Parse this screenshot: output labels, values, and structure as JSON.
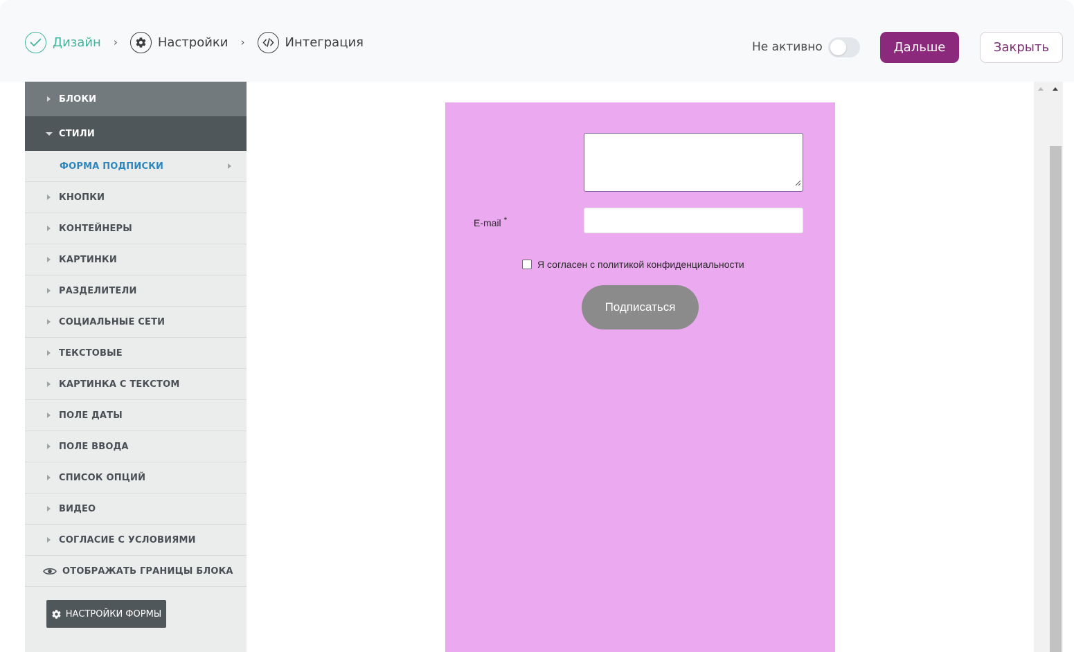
{
  "steps": [
    {
      "label": "Дизайн",
      "icon": "check-icon",
      "state": "done"
    },
    {
      "label": "Настройки",
      "icon": "gear-icon",
      "state": "pending"
    },
    {
      "label": "Интеграция",
      "icon": "code-icon",
      "state": "pending"
    }
  ],
  "step_separator": "›",
  "header": {
    "status_label": "Не активно",
    "toggle_on": false,
    "next_label": "Дальше",
    "close_label": "Закрыть",
    "accent_color": "#8b2a7d",
    "done_color": "#43b49c"
  },
  "sidebar": {
    "blocks_label": "БЛОКИ",
    "styles_label": "СТИЛИ",
    "active_item": "ФОРМА ПОДПИСКИ",
    "items": [
      "КНОПКИ",
      "КОНТЕЙНЕРЫ",
      "КАРТИНКИ",
      "РАЗДЕЛИТЕЛИ",
      "СОЦИАЛЬНЫЕ СЕТИ",
      "ТЕКСТОВЫЕ",
      "КАРТИНКА С ТЕКСТОМ",
      "ПОЛЕ ДАТЫ",
      "ПОЛЕ ВВОДА",
      "СПИСОК ОПЦИЙ",
      "ВИДЕО",
      "СОГЛАСИЕ С УСЛОВИЯМИ"
    ],
    "show_borders_label": "ОТОБРАЖАТЬ ГРАНИЦЫ БЛОКА",
    "form_settings_label": "НАСТРОЙКИ ФОРМЫ"
  },
  "preview": {
    "background_color": "#eba9ef",
    "textarea_value": "",
    "email_label": "E-mail",
    "email_required_mark": "*",
    "email_value": "",
    "consent_label": "Я согласен с политикой конфиденциальности",
    "consent_checked": false,
    "subscribe_label": "Подписаться"
  }
}
